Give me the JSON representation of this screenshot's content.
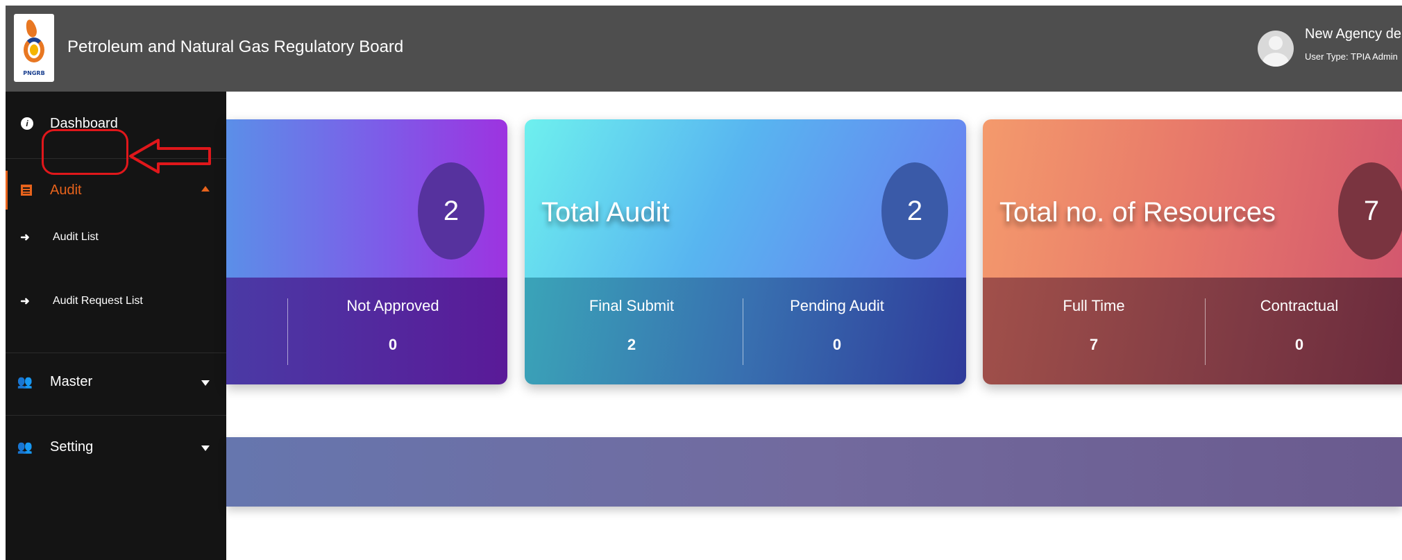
{
  "header": {
    "logo_text": "PNGRB",
    "title": "Petroleum and Natural Gas Regulatory Board",
    "user_name": "New Agency demo",
    "user_type": "User Type: TPIA Admin"
  },
  "sidebar": {
    "items": [
      {
        "label": "Dashboard",
        "icon": "info-icon"
      },
      {
        "label": "Audit",
        "icon": "list-icon",
        "expanded": true,
        "color": "#e8631c"
      },
      {
        "label": "Audit List",
        "icon": "arrow-right-icon"
      },
      {
        "label": "Audit Request List",
        "icon": "arrow-right-icon"
      },
      {
        "label": "Master",
        "icon": "users-icon"
      },
      {
        "label": "Setting",
        "icon": "users-icon"
      }
    ]
  },
  "cards": [
    {
      "title": "",
      "count": "2",
      "stats": [
        {
          "label": "Not Approved",
          "value": "0"
        }
      ]
    },
    {
      "title": "Total Audit",
      "count": "2",
      "stats": [
        {
          "label": "Final Submit",
          "value": "2"
        },
        {
          "label": "Pending Audit",
          "value": "0"
        }
      ]
    },
    {
      "title": "Total no. of Resources",
      "count": "7",
      "stats": [
        {
          "label": "Full Time",
          "value": "7"
        },
        {
          "label": "Contractual",
          "value": "0"
        }
      ]
    }
  ],
  "colors": {
    "header_bg": "#4e4e4e",
    "sidebar_bg": "#141414",
    "accent": "#e8631c",
    "annotation": "#e0171b"
  }
}
